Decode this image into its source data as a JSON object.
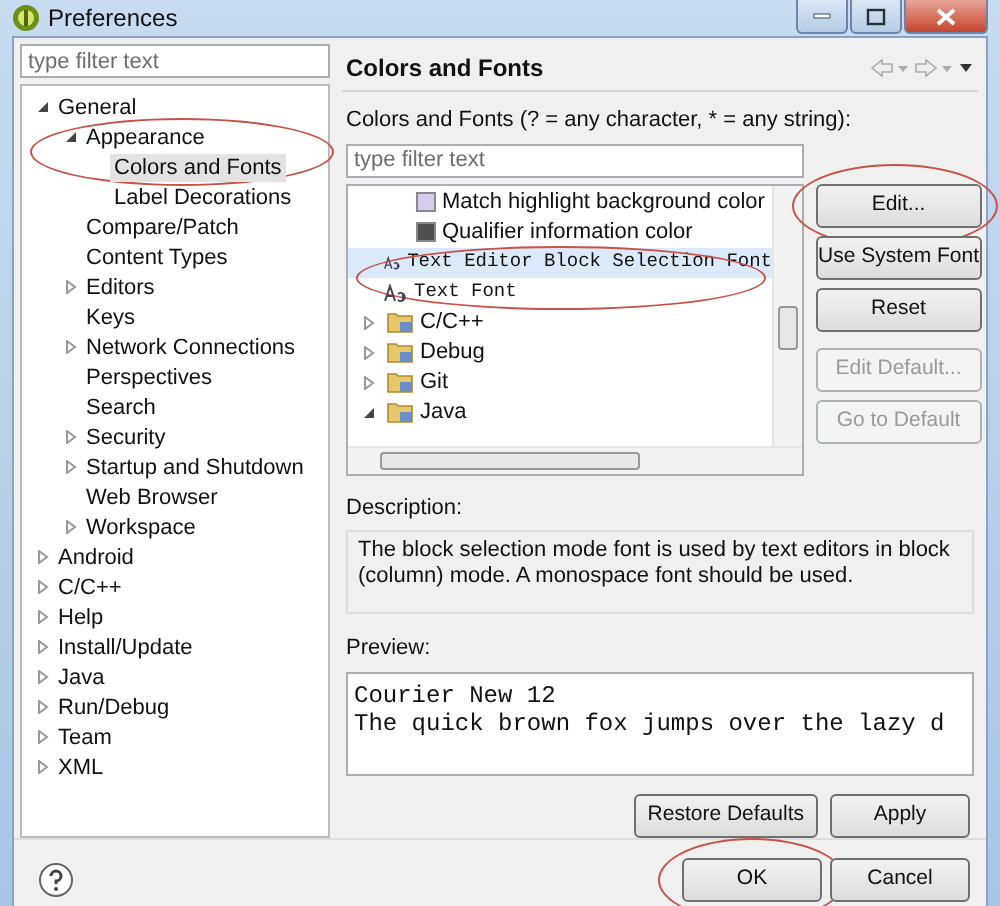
{
  "window": {
    "title": "Preferences"
  },
  "sidebar": {
    "filter_placeholder": "type filter text",
    "tree": [
      {
        "label": "General",
        "expanded": true,
        "selected": false,
        "children": [
          {
            "label": "Appearance",
            "expanded": true,
            "selected": false,
            "circled": true,
            "children": [
              {
                "label": "Colors and Fonts",
                "selected": true
              },
              {
                "label": "Label Decorations",
                "selected": false
              }
            ]
          },
          {
            "label": "Compare/Patch",
            "selected": false
          },
          {
            "label": "Content Types",
            "selected": false
          },
          {
            "label": "Editors",
            "expanded": false,
            "selected": false
          },
          {
            "label": "Keys",
            "selected": false
          },
          {
            "label": "Network Connections",
            "expanded": false,
            "selected": false
          },
          {
            "label": "Perspectives",
            "selected": false
          },
          {
            "label": "Search",
            "selected": false
          },
          {
            "label": "Security",
            "expanded": false,
            "selected": false
          },
          {
            "label": "Startup and Shutdown",
            "expanded": false,
            "selected": false
          },
          {
            "label": "Web Browser",
            "selected": false
          },
          {
            "label": "Workspace",
            "expanded": false,
            "selected": false
          }
        ]
      },
      {
        "label": "Android",
        "expanded": false,
        "selected": false
      },
      {
        "label": "C/C++",
        "expanded": false,
        "selected": false
      },
      {
        "label": "Help",
        "expanded": false,
        "selected": false
      },
      {
        "label": "Install/Update",
        "expanded": false,
        "selected": false
      },
      {
        "label": "Java",
        "expanded": false,
        "selected": false
      },
      {
        "label": "Run/Debug",
        "expanded": false,
        "selected": false
      },
      {
        "label": "Team",
        "expanded": false,
        "selected": false
      },
      {
        "label": "XML",
        "expanded": false,
        "selected": false
      }
    ]
  },
  "page": {
    "title": "Colors and Fonts",
    "filter_label": "Colors and Fonts (? = any character, * = any string):",
    "filter_placeholder": "type filter text",
    "items": [
      {
        "kind": "color",
        "label": "Match highlight background color",
        "color": "#d4cdf0",
        "selected": false,
        "circled": false
      },
      {
        "kind": "color",
        "label": "Qualifier information color",
        "color": "#505050",
        "selected": false,
        "circled": false
      },
      {
        "kind": "font",
        "label": "Text Editor Block Selection Font",
        "selected": true,
        "circled": true
      },
      {
        "kind": "font",
        "label": "Text Font",
        "selected": false,
        "circled": false
      },
      {
        "kind": "category",
        "label": "C/C++",
        "expanded": false,
        "selected": false,
        "circled": false
      },
      {
        "kind": "category",
        "label": "Debug",
        "expanded": false,
        "selected": false,
        "circled": false
      },
      {
        "kind": "category",
        "label": "Git",
        "expanded": false,
        "selected": false,
        "circled": false
      },
      {
        "kind": "category",
        "label": "Java",
        "expanded": true,
        "selected": false,
        "circled": false
      }
    ],
    "side_buttons": [
      {
        "label": "Edit...",
        "disabled": false,
        "circled": true
      },
      {
        "label": "Use System Font",
        "disabled": false,
        "circled": false
      },
      {
        "label": "Reset",
        "disabled": false,
        "circled": false
      },
      {
        "label": "Edit Default...",
        "disabled": true,
        "circled": false
      },
      {
        "label": "Go to Default",
        "disabled": true,
        "circled": false
      }
    ],
    "description_label": "Description:",
    "description": "The block selection mode font is used by text editors in block (column) mode. A monospace font should be used.",
    "preview_label": "Preview:",
    "preview_lines": [
      "Courier New 12",
      "The quick brown fox jumps over the lazy d"
    ],
    "page_buttons": [
      {
        "label": "Restore Defaults",
        "circled": false
      },
      {
        "label": "Apply",
        "circled": false
      }
    ]
  },
  "footer_buttons": [
    {
      "label": "OK",
      "circled": true
    },
    {
      "label": "Cancel",
      "circled": false
    }
  ]
}
